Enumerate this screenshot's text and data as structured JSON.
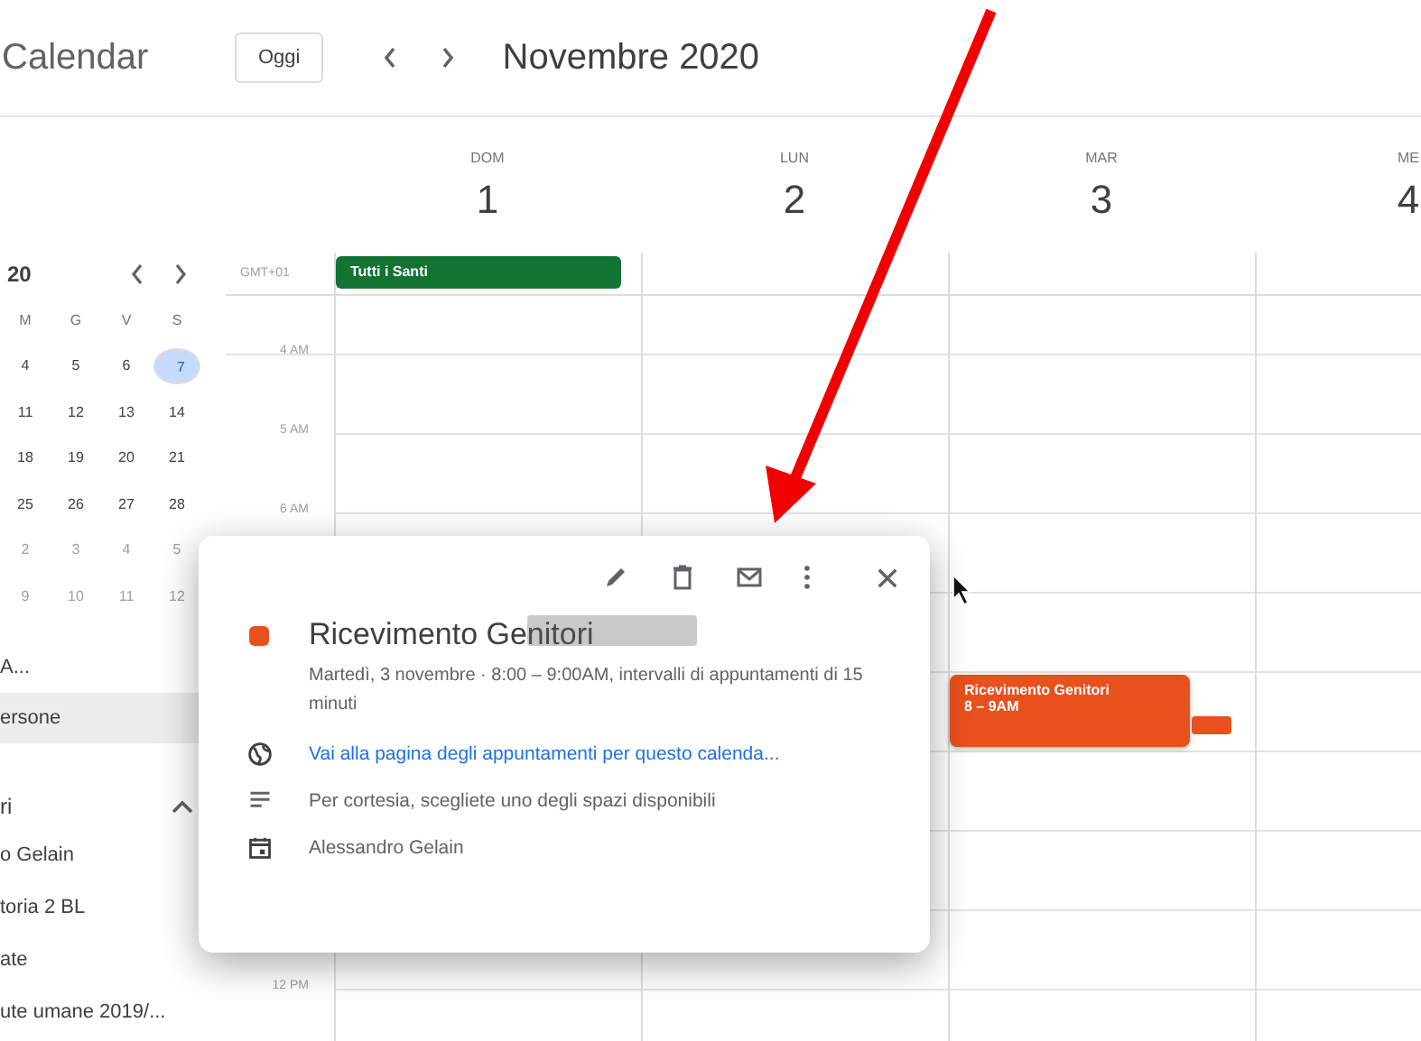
{
  "app": {
    "title": "Calendar"
  },
  "toolbar": {
    "today_button": "Oggi",
    "period": "Novembre 2020"
  },
  "mini_calendar": {
    "title": "20",
    "weekdays": [
      "M",
      "G",
      "V",
      "S"
    ],
    "weeks": [
      [
        {
          "day": "4",
          "today": false,
          "other_month": false
        },
        {
          "day": "5",
          "today": false,
          "other_month": false
        },
        {
          "day": "6",
          "today": false,
          "other_month": false
        },
        {
          "day": "7",
          "today": true,
          "other_month": false
        }
      ],
      [
        {
          "day": "11",
          "today": false,
          "other_month": false
        },
        {
          "day": "12",
          "today": false,
          "other_month": false
        },
        {
          "day": "13",
          "today": false,
          "other_month": false
        },
        {
          "day": "14",
          "today": false,
          "other_month": false
        }
      ],
      [
        {
          "day": "18",
          "today": false,
          "other_month": false
        },
        {
          "day": "19",
          "today": false,
          "other_month": false
        },
        {
          "day": "20",
          "today": false,
          "other_month": false
        },
        {
          "day": "21",
          "today": false,
          "other_month": false
        }
      ],
      [
        {
          "day": "25",
          "today": false,
          "other_month": false
        },
        {
          "day": "26",
          "today": false,
          "other_month": false
        },
        {
          "day": "27",
          "today": false,
          "other_month": false
        },
        {
          "day": "28",
          "today": false,
          "other_month": false
        }
      ],
      [
        {
          "day": "2",
          "today": false,
          "other_month": true
        },
        {
          "day": "3",
          "today": false,
          "other_month": true
        },
        {
          "day": "4",
          "today": false,
          "other_month": true
        },
        {
          "day": "5",
          "today": false,
          "other_month": true
        }
      ],
      [
        {
          "day": "9",
          "today": false,
          "other_month": true
        },
        {
          "day": "10",
          "today": false,
          "other_month": true
        },
        {
          "day": "11",
          "today": false,
          "other_month": true
        },
        {
          "day": "12",
          "today": false,
          "other_month": true
        }
      ]
    ]
  },
  "sidebar": {
    "items": [
      {
        "label": "A...",
        "selected": false
      },
      {
        "label": "ersone",
        "selected": true
      }
    ],
    "section": {
      "title": "ri",
      "expanded": true,
      "calendars": [
        "o Gelain",
        "toria 2 BL",
        "ate",
        "ute umane 2019/..."
      ]
    }
  },
  "timezone": "GMT+01",
  "hour_labels": [
    "4 AM",
    "5 AM",
    "6 AM",
    "12 PM"
  ],
  "days": [
    {
      "weekday": "DOM",
      "date": "1",
      "all_day": [
        {
          "title": "Tutti i Santi",
          "color": "#137333"
        }
      ]
    },
    {
      "weekday": "LUN",
      "date": "2"
    },
    {
      "weekday": "MAR",
      "date": "3",
      "events": [
        {
          "title": "Ricevimento Genitori",
          "time": "8 – 9AM",
          "color": "#e8501e"
        }
      ]
    },
    {
      "weekday": "ME",
      "date": "4"
    }
  ],
  "popup": {
    "title": "Ricevimento Genitori",
    "color": "#e8501e",
    "when": "Martedì, 3 novembre  ·  8:00 – 9:00AM, intervalli di appuntamenti di 15 minuti",
    "link": "Vai alla pagina degli appuntamenti per questo calenda...",
    "description": "Per cortesia, scegliete uno degli spazi disponibili",
    "calendar": "Alessandro Gelain"
  }
}
